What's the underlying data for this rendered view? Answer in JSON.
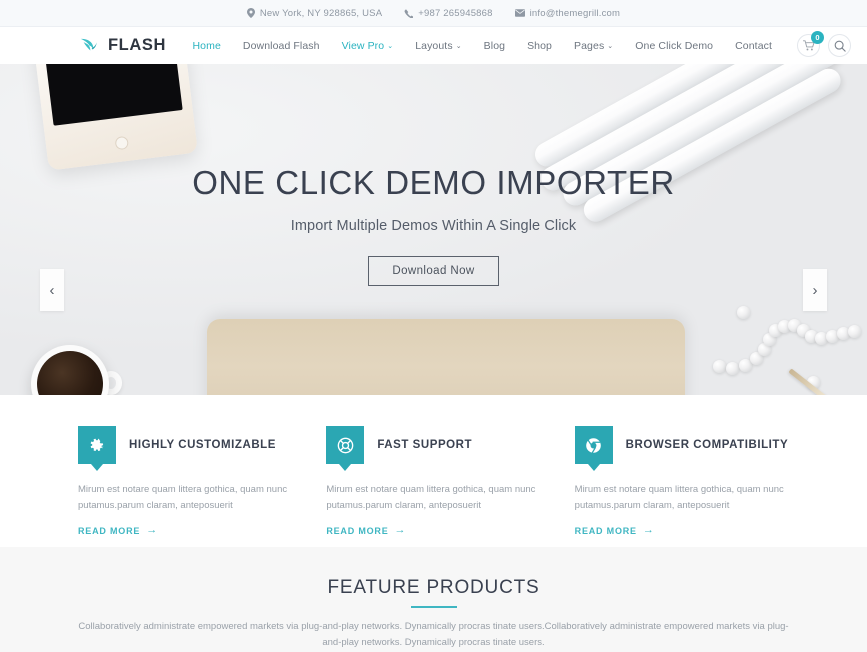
{
  "topbar": {
    "address": "New York, NY 928865, USA",
    "phone": "+987 265945868",
    "email": "info@themegrill.com"
  },
  "nav": {
    "brand": "FLASH",
    "items": [
      {
        "label": "Home",
        "active": true,
        "caret": ""
      },
      {
        "label": "Download Flash",
        "active": false,
        "caret": ""
      },
      {
        "label": "View Pro",
        "active": true,
        "caret": "⌄"
      },
      {
        "label": "Layouts",
        "active": false,
        "caret": "⌄"
      },
      {
        "label": "Blog",
        "active": false,
        "caret": ""
      },
      {
        "label": "Shop",
        "active": false,
        "caret": ""
      },
      {
        "label": "Pages",
        "active": false,
        "caret": "⌄"
      },
      {
        "label": "One Click Demo",
        "active": false,
        "caret": ""
      },
      {
        "label": "Contact",
        "active": false,
        "caret": ""
      }
    ],
    "cart_count": "0"
  },
  "hero": {
    "title": "ONE CLICK DEMO IMPORTER",
    "subtitle": "Import Multiple Demos Within A Single Click",
    "button": "Download Now",
    "prev": "‹",
    "next": "›"
  },
  "features": [
    {
      "title": "HIGHLY CUSTOMIZABLE",
      "desc": "Mirum est notare quam littera gothica, quam nunc putamus.parum claram, anteposuerit",
      "more": "READ MORE",
      "arrow": "→"
    },
    {
      "title": "FAST SUPPORT",
      "desc": "Mirum est notare quam littera gothica, quam nunc putamus.parum claram, anteposuerit",
      "more": "READ MORE",
      "arrow": "→"
    },
    {
      "title": "BROWSER COMPATIBILITY",
      "desc": "Mirum est notare quam littera gothica, quam nunc putamus.parum claram, anteposuerit",
      "more": "READ MORE",
      "arrow": "→"
    }
  ],
  "feature_products": {
    "title": "FEATURE PRODUCTS",
    "desc": "Collaboratively administrate empowered markets via plug-and-play networks. Dynamically procras tinate users.Collaboratively administrate empowered markets via plug-and-play networks. Dynamically procras tinate users."
  },
  "colors": {
    "accent": "#2bb3c0",
    "icon_bg": "#2ba7b3",
    "text_dark": "#3a4150",
    "text_muted": "#9aa1a9"
  }
}
